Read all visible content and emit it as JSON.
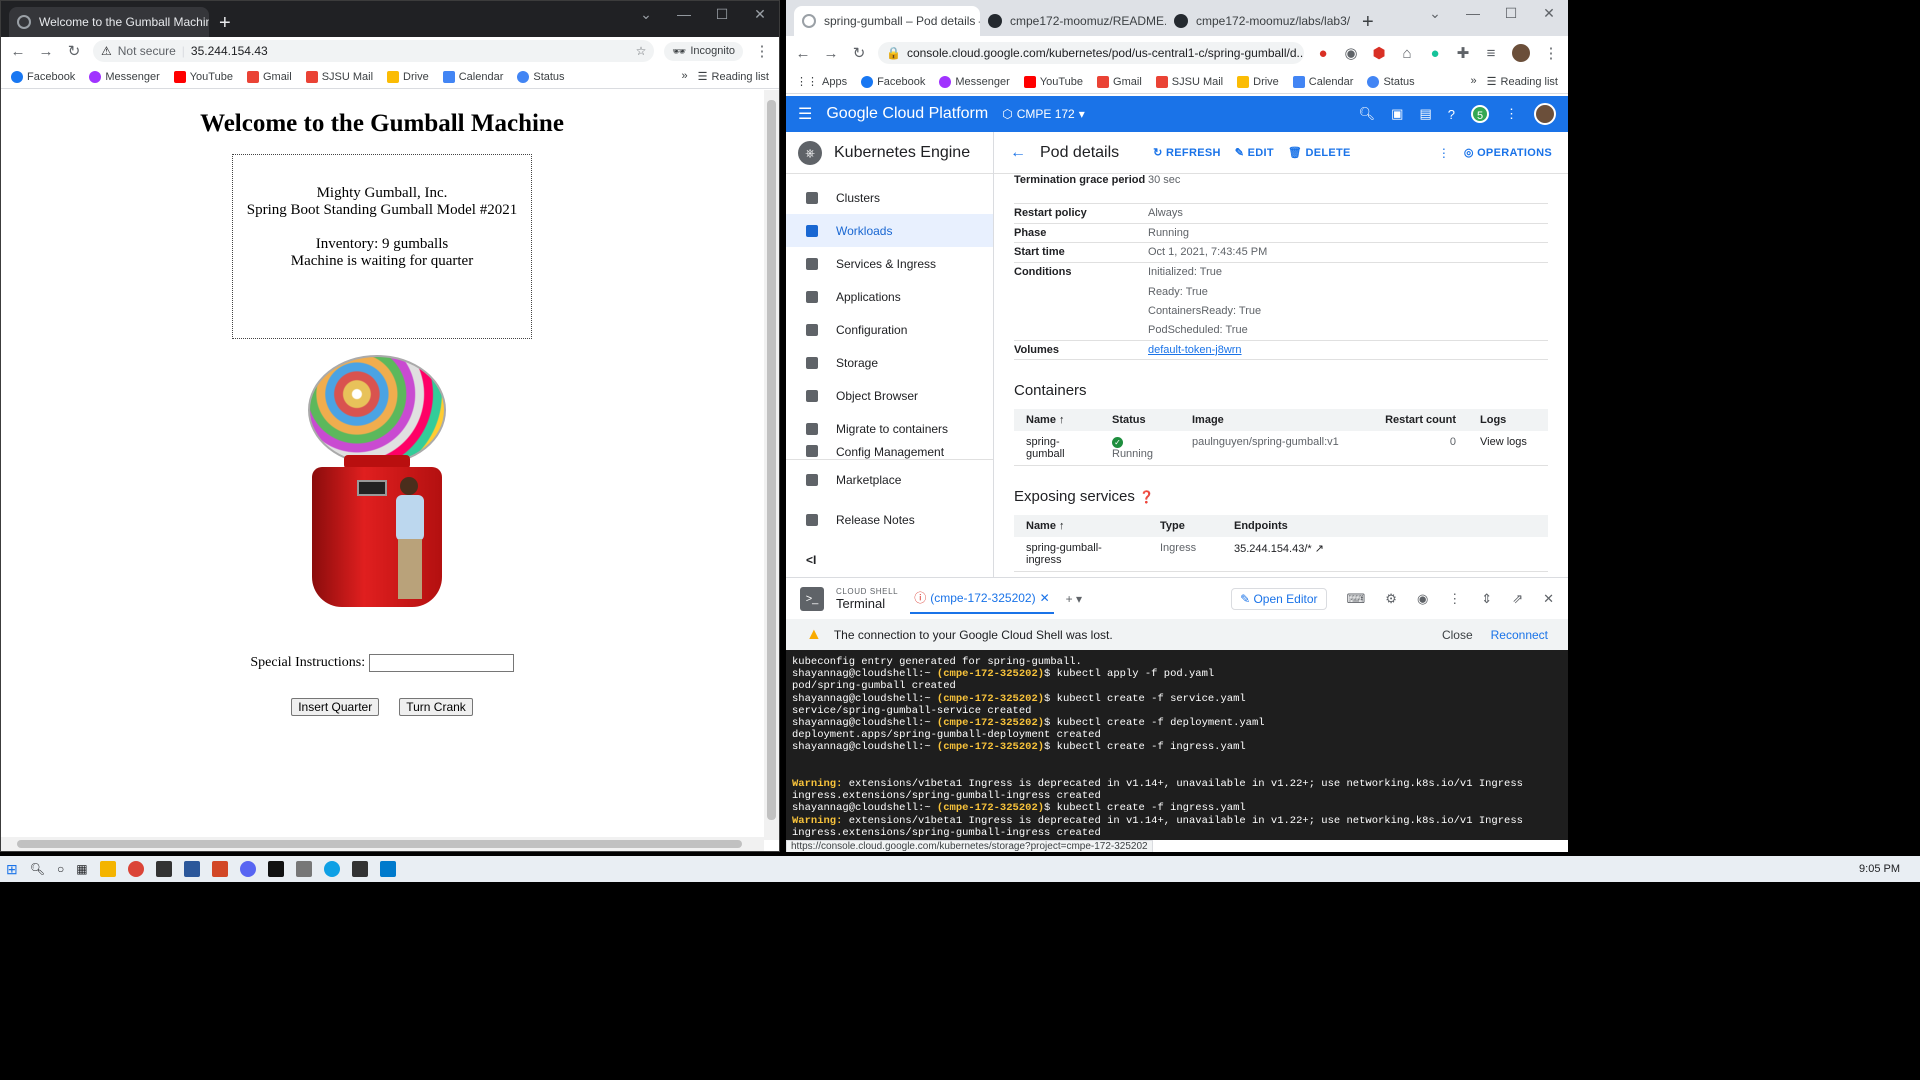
{
  "left_window": {
    "tab_title": "Welcome to the Gumball Machin",
    "address": "35.244.154.43",
    "not_secure_label": "Not secure",
    "incognito_label": "Incognito",
    "bookmarks": [
      "Facebook",
      "Messenger",
      "YouTube",
      "Gmail",
      "SJSU Mail",
      "Drive",
      "Calendar",
      "Status"
    ],
    "reading_list": "Reading list",
    "page": {
      "heading": "Welcome to the Gumball Machine",
      "company": "Mighty Gumball, Inc.",
      "model": "Spring Boot Standing Gumball Model #2021",
      "inventory": "Inventory: 9 gumballs",
      "state": "Machine is waiting for quarter",
      "special_label": "Special Instructions:",
      "special_value": "",
      "insert_button": "Insert Quarter",
      "crank_button": "Turn Crank"
    }
  },
  "right_window": {
    "tabs": [
      "spring-gumball – Pod details –",
      "cmpe172-moomuz/README.m",
      "cmpe172-moomuz/labs/lab3/"
    ],
    "address": "console.cloud.google.com/kubernetes/pod/us-central1-c/spring-gumball/d...",
    "bookmarks": [
      "Apps",
      "Facebook",
      "Messenger",
      "YouTube",
      "Gmail",
      "SJSU Mail",
      "Drive",
      "Calendar",
      "Status"
    ],
    "reading_list": "Reading list",
    "gcp": {
      "brand": "Google Cloud Platform",
      "project": "CMPE 172",
      "notif_count": "5"
    },
    "sidenav": {
      "title": "Kubernetes Engine",
      "items": [
        "Clusters",
        "Workloads",
        "Services & Ingress",
        "Applications",
        "Configuration",
        "Storage",
        "Object Browser",
        "Migrate to containers",
        "Config Management"
      ],
      "marketplace": "Marketplace",
      "release_notes": "Release Notes",
      "collapse": "<I"
    },
    "pod": {
      "title": "Pod details",
      "refresh": "REFRESH",
      "edit": "EDIT",
      "delete": "DELETE",
      "operations": "OPERATIONS",
      "details": [
        {
          "k": "Termination grace period",
          "v": "30 sec"
        },
        {
          "k": "Restart policy",
          "v": "Always"
        },
        {
          "k": "Phase",
          "v": "Running"
        },
        {
          "k": "Start time",
          "v": "Oct 1, 2021, 7:43:45 PM"
        },
        {
          "k": "Conditions",
          "v": "Initialized: True"
        },
        {
          "k": "",
          "v": "Ready: True"
        },
        {
          "k": "",
          "v": "ContainersReady: True"
        },
        {
          "k": "",
          "v": "PodScheduled: True"
        },
        {
          "k": "Volumes",
          "v": "default-token-j8wrn"
        }
      ],
      "containers_title": "Containers",
      "containers_cols": [
        "Name",
        "Status",
        "Image",
        "Restart count",
        "Logs"
      ],
      "container_row": {
        "name": "spring-gumball",
        "status": "Running",
        "image": "paulnguyen/spring-gumball:v1",
        "restarts": "0",
        "logs": "View logs"
      },
      "services_title": "Exposing services",
      "services_cols": [
        "Name",
        "Type",
        "Endpoints"
      ],
      "service_row": {
        "name": "spring-gumball-ingress",
        "type": "Ingress",
        "endpoint": "35.244.154.43/*"
      }
    },
    "shell": {
      "small_label": "CLOUD SHELL",
      "terminal_label": "Terminal",
      "session_tab": "(cmpe-172-325202)",
      "open_editor": "Open Editor",
      "warning": "The connection to your Google Cloud Shell was lost.",
      "close": "Close",
      "reconnect": "Reconnect",
      "lines": [
        {
          "t": "out",
          "text": "kubeconfig entry generated for spring-gumball."
        },
        {
          "t": "cmd",
          "user": "shayannag@cloudshell:~",
          "proj": "(cmpe-172-325202)",
          "cmd": "$ kubectl apply -f pod.yaml"
        },
        {
          "t": "out",
          "text": "pod/spring-gumball created"
        },
        {
          "t": "cmd",
          "user": "shayannag@cloudshell:~",
          "proj": "(cmpe-172-325202)",
          "cmd": "$ kubectl create -f service.yaml"
        },
        {
          "t": "out",
          "text": "service/spring-gumball-service created"
        },
        {
          "t": "cmd",
          "user": "shayannag@cloudshell:~",
          "proj": "(cmpe-172-325202)",
          "cmd": "$ kubectl create -f deployment.yaml"
        },
        {
          "t": "out",
          "text": "deployment.apps/spring-gumball-deployment created"
        },
        {
          "t": "cmd",
          "user": "shayannag@cloudshell:~",
          "proj": "(cmpe-172-325202)",
          "cmd": "$ kubectl create -f ingress.yaml"
        },
        {
          "t": "out",
          "text": ""
        },
        {
          "t": "out",
          "text": ""
        },
        {
          "t": "warn",
          "label": "Warning:",
          "text": " extensions/v1beta1 Ingress is deprecated in v1.14+, unavailable in v1.22+; use networking.k8s.io/v1 Ingress"
        },
        {
          "t": "out",
          "text": "ingress.extensions/spring-gumball-ingress created"
        },
        {
          "t": "cmd",
          "user": "shayannag@cloudshell:~",
          "proj": "(cmpe-172-325202)",
          "cmd": "$ kubectl create -f ingress.yaml"
        },
        {
          "t": "warn",
          "label": "Warning:",
          "text": " extensions/v1beta1 Ingress is deprecated in v1.14+, unavailable in v1.22+; use networking.k8s.io/v1 Ingress"
        },
        {
          "t": "out",
          "text": "ingress.extensions/spring-gumball-ingress created"
        }
      ]
    },
    "status_url": "https://console.cloud.google.com/kubernetes/storage?project=cmpe-172-325202"
  },
  "taskbar": {
    "time": "9:05 PM"
  }
}
